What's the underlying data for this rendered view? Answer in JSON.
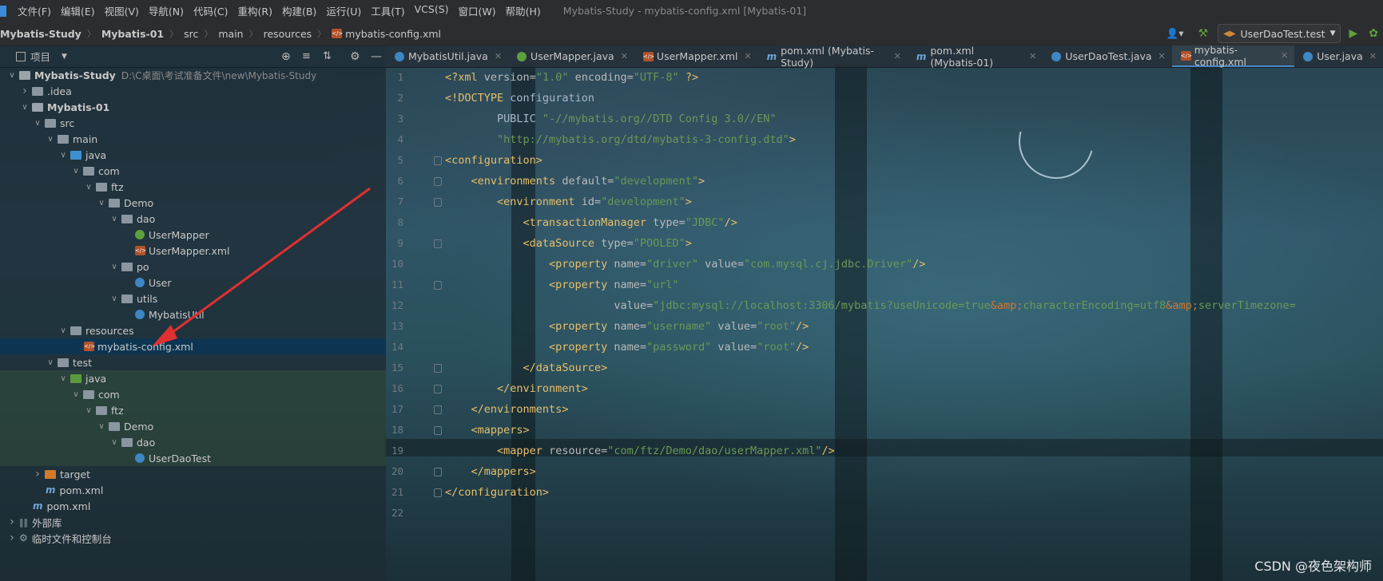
{
  "menubar": {
    "items": [
      "文件(F)",
      "编辑(E)",
      "视图(V)",
      "导航(N)",
      "代码(C)",
      "重构(R)",
      "构建(B)",
      "运行(U)",
      "工具(T)",
      "VCS(S)",
      "窗口(W)",
      "帮助(H)"
    ],
    "title": "Mybatis-Study - mybatis-config.xml [Mybatis-01]"
  },
  "breadcrumb": [
    "Mybatis-Study",
    "Mybatis-01",
    "src",
    "main",
    "resources",
    "mybatis-config.xml"
  ],
  "run_config": "UserDaoTest.test",
  "project_panel": {
    "title": "项目",
    "root_path": "D:\\C桌面\\考试准备文件\\new\\Mybatis-Study"
  },
  "tree": [
    {
      "label": "Mybatis-Study",
      "depth": 0,
      "icon": "folder-module",
      "chev": "down",
      "bold": true,
      "extra": "D:\\C桌面\\考试准备文件\\new\\Mybatis-Study"
    },
    {
      "label": ".idea",
      "depth": 1,
      "icon": "folder",
      "chev": "right"
    },
    {
      "label": "Mybatis-01",
      "depth": 1,
      "icon": "folder-module",
      "chev": "down",
      "bold": true
    },
    {
      "label": "src",
      "depth": 2,
      "icon": "folder",
      "chev": "down"
    },
    {
      "label": "main",
      "depth": 3,
      "icon": "folder",
      "chev": "down"
    },
    {
      "label": "java",
      "depth": 4,
      "icon": "folder-blue",
      "chev": "down"
    },
    {
      "label": "com",
      "depth": 5,
      "icon": "folder",
      "chev": "down"
    },
    {
      "label": "ftz",
      "depth": 6,
      "icon": "folder",
      "chev": "down"
    },
    {
      "label": "Demo",
      "depth": 7,
      "icon": "folder",
      "chev": "down"
    },
    {
      "label": "dao",
      "depth": 8,
      "icon": "folder",
      "chev": "down"
    },
    {
      "label": "UserMapper",
      "depth": 9,
      "icon": "interface"
    },
    {
      "label": "UserMapper.xml",
      "depth": 9,
      "icon": "xml"
    },
    {
      "label": "po",
      "depth": 8,
      "icon": "folder",
      "chev": "down"
    },
    {
      "label": "User",
      "depth": 9,
      "icon": "class"
    },
    {
      "label": "utils",
      "depth": 8,
      "icon": "folder",
      "chev": "down"
    },
    {
      "label": "MybatisUtil",
      "depth": 9,
      "icon": "class"
    },
    {
      "label": "resources",
      "depth": 4,
      "icon": "folder-res",
      "chev": "down"
    },
    {
      "label": "mybatis-config.xml",
      "depth": 5,
      "icon": "xml",
      "selected": true
    },
    {
      "label": "test",
      "depth": 3,
      "icon": "folder",
      "chev": "down"
    },
    {
      "label": "java",
      "depth": 4,
      "icon": "folder-green",
      "chev": "down",
      "test": true
    },
    {
      "label": "com",
      "depth": 5,
      "icon": "folder",
      "chev": "down",
      "test": true
    },
    {
      "label": "ftz",
      "depth": 6,
      "icon": "folder",
      "chev": "down",
      "test": true
    },
    {
      "label": "Demo",
      "depth": 7,
      "icon": "folder",
      "chev": "down",
      "test": true
    },
    {
      "label": "dao",
      "depth": 8,
      "icon": "folder",
      "chev": "down",
      "test": true
    },
    {
      "label": "UserDaoTest",
      "depth": 9,
      "icon": "test-class",
      "test": true
    },
    {
      "label": "target",
      "depth": 2,
      "icon": "folder-orange",
      "chev": "right"
    },
    {
      "label": "pom.xml",
      "depth": 2,
      "icon": "maven"
    },
    {
      "label": "pom.xml",
      "depth": 1,
      "icon": "maven"
    },
    {
      "label": "外部库",
      "depth": 0,
      "icon": "library",
      "chev": "right"
    },
    {
      "label": "临时文件和控制台",
      "depth": 0,
      "icon": "scratch",
      "chev": "right"
    }
  ],
  "tabs": [
    {
      "label": "MybatisUtil.java",
      "icon": "class"
    },
    {
      "label": "UserMapper.java",
      "icon": "interface"
    },
    {
      "label": "UserMapper.xml",
      "icon": "xml"
    },
    {
      "label": "pom.xml (Mybatis-Study)",
      "icon": "maven"
    },
    {
      "label": "pom.xml (Mybatis-01)",
      "icon": "maven"
    },
    {
      "label": "UserDaoTest.java",
      "icon": "test-class"
    },
    {
      "label": "mybatis-config.xml",
      "icon": "xml",
      "active": true
    },
    {
      "label": "User.java",
      "icon": "class"
    }
  ],
  "code_lines": [
    "<?xml version=\"1.0\" encoding=\"UTF-8\" ?>",
    "<!DOCTYPE configuration",
    "        PUBLIC \"-//mybatis.org//DTD Config 3.0//EN\"",
    "        \"http://mybatis.org/dtd/mybatis-3-config.dtd\">",
    "<configuration>",
    "    <environments default=\"development\">",
    "        <environment id=\"development\">",
    "            <transactionManager type=\"JDBC\"/>",
    "            <dataSource type=\"POOLED\">",
    "                <property name=\"driver\" value=\"com.mysql.cj.jdbc.Driver\"/>",
    "                <property name=\"url\"",
    "                          value=\"jdbc:mysql://localhost:3306/mybatis?useUnicode=true&amp;characterEncoding=utf8&amp;serverTimezone=",
    "                <property name=\"username\" value=\"root\"/>",
    "                <property name=\"password\" value=\"root\"/>",
    "            </dataSource>",
    "        </environment>",
    "    </environments>",
    "    <mappers>",
    "        <mapper resource=\"com/ftz/Demo/dao/userMapper.xml\"/>",
    "    </mappers>",
    "</configuration>",
    ""
  ],
  "fold_lines": [
    5,
    6,
    7,
    9,
    11,
    15,
    16,
    17,
    18,
    20,
    21
  ],
  "watermark": "CSDN @夜色架构师",
  "colors": {
    "tag": "#e8bf6a",
    "attr_value": "#6a9955",
    "accent": "#4a88c7",
    "selection": "#0d3552"
  }
}
